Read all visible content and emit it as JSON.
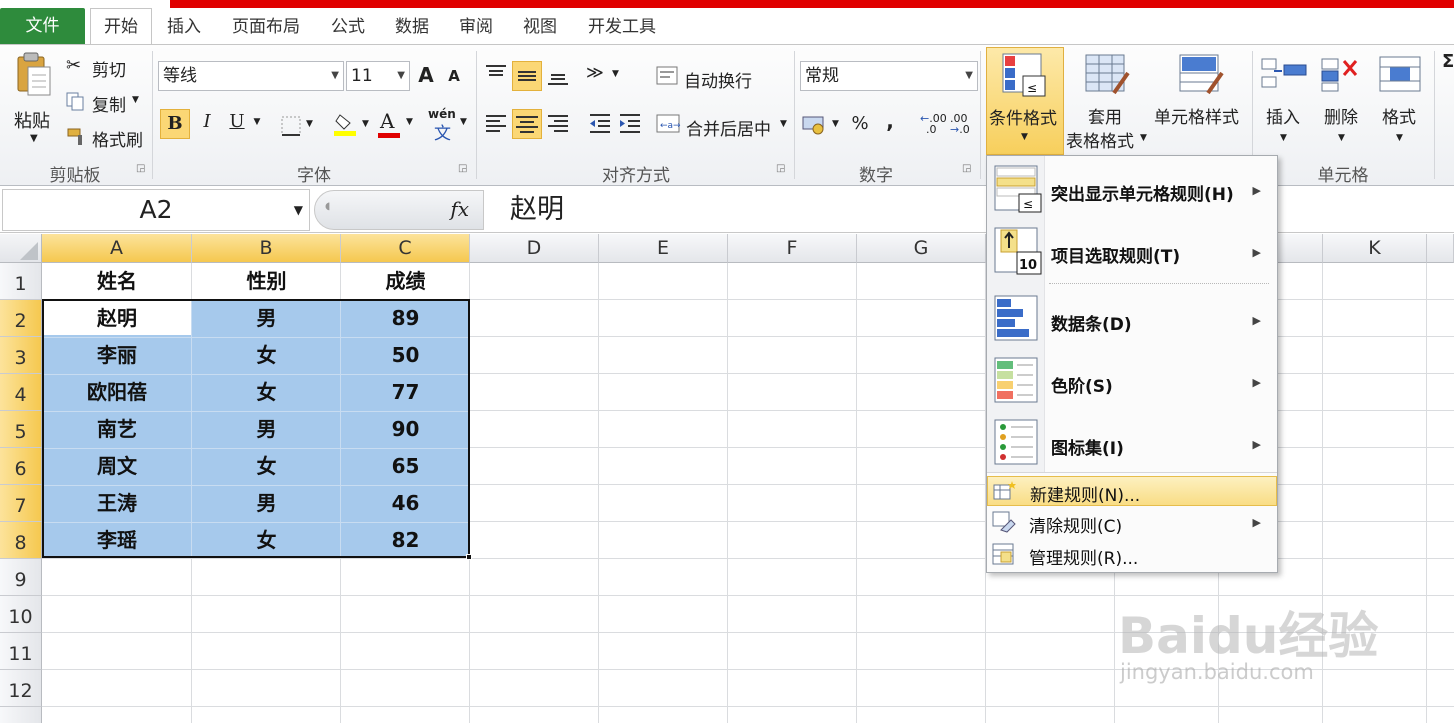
{
  "tabs": [
    {
      "label": "文件"
    },
    {
      "label": "开始"
    },
    {
      "label": "插入"
    },
    {
      "label": "页面布局"
    },
    {
      "label": "公式"
    },
    {
      "label": "数据"
    },
    {
      "label": "审阅"
    },
    {
      "label": "视图"
    },
    {
      "label": "开发工具"
    }
  ],
  "clipboard": {
    "paste": "粘贴",
    "cut": "剪切",
    "copy": "复制",
    "format_painter": "格式刷",
    "title": "剪贴板"
  },
  "font": {
    "name": "等线",
    "size": "11",
    "grow": "A",
    "shrink": "A",
    "bold": "B",
    "italic": "I",
    "underline": "U",
    "font_color": "A",
    "phonetic": "wén",
    "phonetic_sub": "文",
    "title": "字体"
  },
  "alignment": {
    "wrap_text": "自动换行",
    "merge_center": "合并后居中",
    "title": "对齐方式"
  },
  "number": {
    "format": "常规",
    "percent": "%",
    "comma": ",",
    "inc_decimal": ".00",
    "dec_decimal": ".00",
    "title": "数字"
  },
  "styles": {
    "conditional_format": "条件格式",
    "table_format_1": "套用",
    "table_format_2": "表格格式",
    "cell_styles": "单元格样式"
  },
  "cells_group": {
    "insert": "插入",
    "delete": "删除",
    "format": "格式",
    "title": "单元格"
  },
  "formula_bar": {
    "name_box": "A2",
    "fx": "fx",
    "content": "赵明"
  },
  "columns": [
    "A",
    "B",
    "C",
    "D",
    "E",
    "F",
    "G",
    "K"
  ],
  "rows": [
    "1",
    "2",
    "3",
    "4",
    "5",
    "6",
    "7",
    "8",
    "9",
    "10",
    "11",
    "12"
  ],
  "sheet": [
    [
      "姓名",
      "性别",
      "成绩"
    ],
    [
      "赵明",
      "男",
      "89"
    ],
    [
      "李丽",
      "女",
      "50"
    ],
    [
      "欧阳蓓",
      "女",
      "77"
    ],
    [
      "南艺",
      "男",
      "90"
    ],
    [
      "周文",
      "女",
      "65"
    ],
    [
      "王涛",
      "男",
      "46"
    ],
    [
      "李瑶",
      "女",
      "82"
    ]
  ],
  "menu": {
    "highlight_rules": "突出显示单元格规则(H)",
    "top_rules": "项目选取规则(T)",
    "data_bars": "数据条(D)",
    "color_scales": "色阶(S)",
    "icon_sets": "图标集(I)",
    "new_rule": "新建规则(N)...",
    "clear_rules": "清除规则(C)",
    "manage_rules": "管理规则(R)..."
  },
  "watermark": {
    "text": "Baidu经验",
    "url": "jingyan.baidu.com"
  }
}
